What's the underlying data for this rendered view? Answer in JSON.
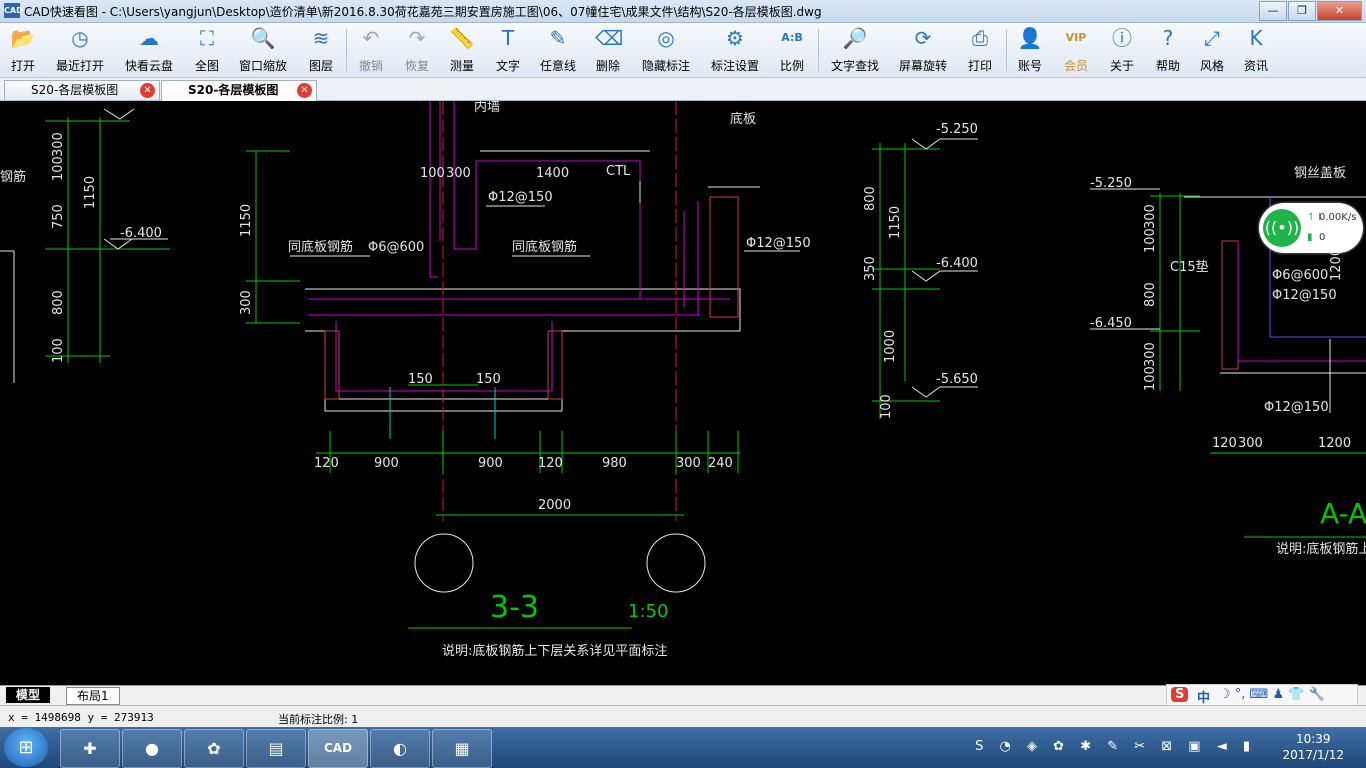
{
  "window": {
    "icon_text": "CAD",
    "title": "CAD快速看图 - C:\\Users\\yangjun\\Desktop\\造价清单\\新2016.8.30荷花嘉苑三期安置房施工图\\06、07幢住宅\\成果文件\\结构\\S20-各层模板图.dwg",
    "buttons": {
      "minimize": "—",
      "maximize": "❐",
      "close": "✕"
    }
  },
  "toolbar": {
    "open": "打开",
    "recent": "最近打开",
    "cloud": "快看云盘",
    "full": "全图",
    "window_zoom": "窗口缩放",
    "layers": "图层",
    "undo": "撤销",
    "redo": "恢复",
    "measure": "测量",
    "text": "文字",
    "freehand": "任意线",
    "delete": "删除",
    "hide_dims": "隐藏标注",
    "dim_settings": "标注设置",
    "ratio": "比例",
    "text_search": "文字查找",
    "rotate": "屏幕旋转",
    "print": "打印",
    "account": "账号",
    "vip": "会员",
    "about": "关于",
    "help": "帮助",
    "style": "风格",
    "news": "资讯",
    "vip_badge": "VIP",
    "ratio_icon": "A:B"
  },
  "tabs": [
    {
      "label": "S20-各层模板图",
      "active": false
    },
    {
      "label": "S20-各层模板图",
      "active": true
    }
  ],
  "drawing": {
    "section_title": "3-3",
    "section_scale": "1:50",
    "note": "说明:底板钢筋上下层关系详见平面标注",
    "note_right": "说明:底板钢筋上下",
    "section_right": "A-A",
    "labels": {
      "inner_wall": "内墙",
      "bottom_plate": "底板",
      "same_rebar_1": "同底板钢筋",
      "same_rebar_2": "同底板钢筋",
      "phi6": "Φ6@600",
      "phi12_top": "Φ12@150",
      "phi12_right": "Φ12@150",
      "ctl": "CTL",
      "left_rebar": "钢筋",
      "steel_cover": "钢丝盖板",
      "c15": "C15垫",
      "r_phi6": "Φ6@600",
      "r_phi12_a": "Φ12@150",
      "r_phi12_b": "Φ12@150"
    },
    "elevations": [
      "-5.250",
      "-6.400",
      "-5.650",
      "-5.250",
      "-6.450",
      "-6.400"
    ],
    "dims_bottom": [
      "120",
      "900",
      "900",
      "120",
      "980",
      "300",
      "240"
    ],
    "dim_total": "2000",
    "dims_small": [
      "150",
      "150",
      "100",
      "300",
      "1400"
    ],
    "dims_left": [
      "300",
      "100",
      "750",
      "1150",
      "800",
      "100",
      "1150",
      "300"
    ],
    "dims_mid": [
      "800",
      "1150",
      "350",
      "1000",
      "100"
    ],
    "dims_right": [
      "100",
      "300",
      "800",
      "100",
      "300",
      "1200",
      "120",
      "300",
      "1200"
    ]
  },
  "layout_tabs": {
    "model": "模型",
    "layout1": "布局1"
  },
  "status": {
    "coords": "x = 1498698  y = 273913",
    "scale": "当前标注比例: 1"
  },
  "ime": {
    "logo": "S",
    "lang": "中",
    "icons": "☽ °, ⌨ ♟ 👕 🔧"
  },
  "net_widget": {
    "speed": "0.00K/s",
    "count": "0",
    "up_icon": "↿⇂",
    "bat_icon": "▮",
    "wifi_icon": "((•))"
  },
  "taskbar": {
    "start": "⊞",
    "apps": [
      "✚",
      "●",
      "✿",
      "▤",
      "CAD",
      "◐",
      "▦"
    ],
    "tray_icons": "S ◔ ◈ ✿ ✱ ✎ ✂ ⊠ ▣ ◄ ▮",
    "time": "10:39",
    "date": "2017/1/12"
  }
}
